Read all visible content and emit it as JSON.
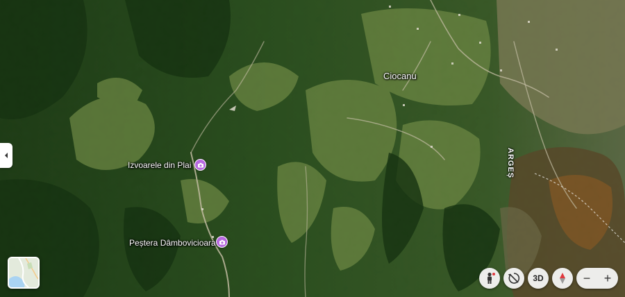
{
  "map": {
    "places": [
      {
        "id": "ciocanu",
        "label": "Ciocanu"
      }
    ],
    "pois": [
      {
        "id": "izvoarele",
        "label": "Izvoarele din Plai",
        "icon": "camera-icon",
        "color": "#b768e0"
      },
      {
        "id": "pestera",
        "label": "Peștera Dâmbovicioara",
        "icon": "camera-icon",
        "color": "#b768e0"
      }
    ],
    "roads": [
      {
        "id": "arges",
        "label": "ARGEȘ"
      }
    ]
  },
  "controls": {
    "side_panel_icon": "chevron-left-icon",
    "layers_icon": "map-layers-icon",
    "street_view_icon": "pegman-icon",
    "rotate_icon": "rotate-icon",
    "three_d_label": "3D",
    "compass_icon": "compass-icon",
    "zoom_out_label": "−",
    "zoom_in_label": "+"
  }
}
